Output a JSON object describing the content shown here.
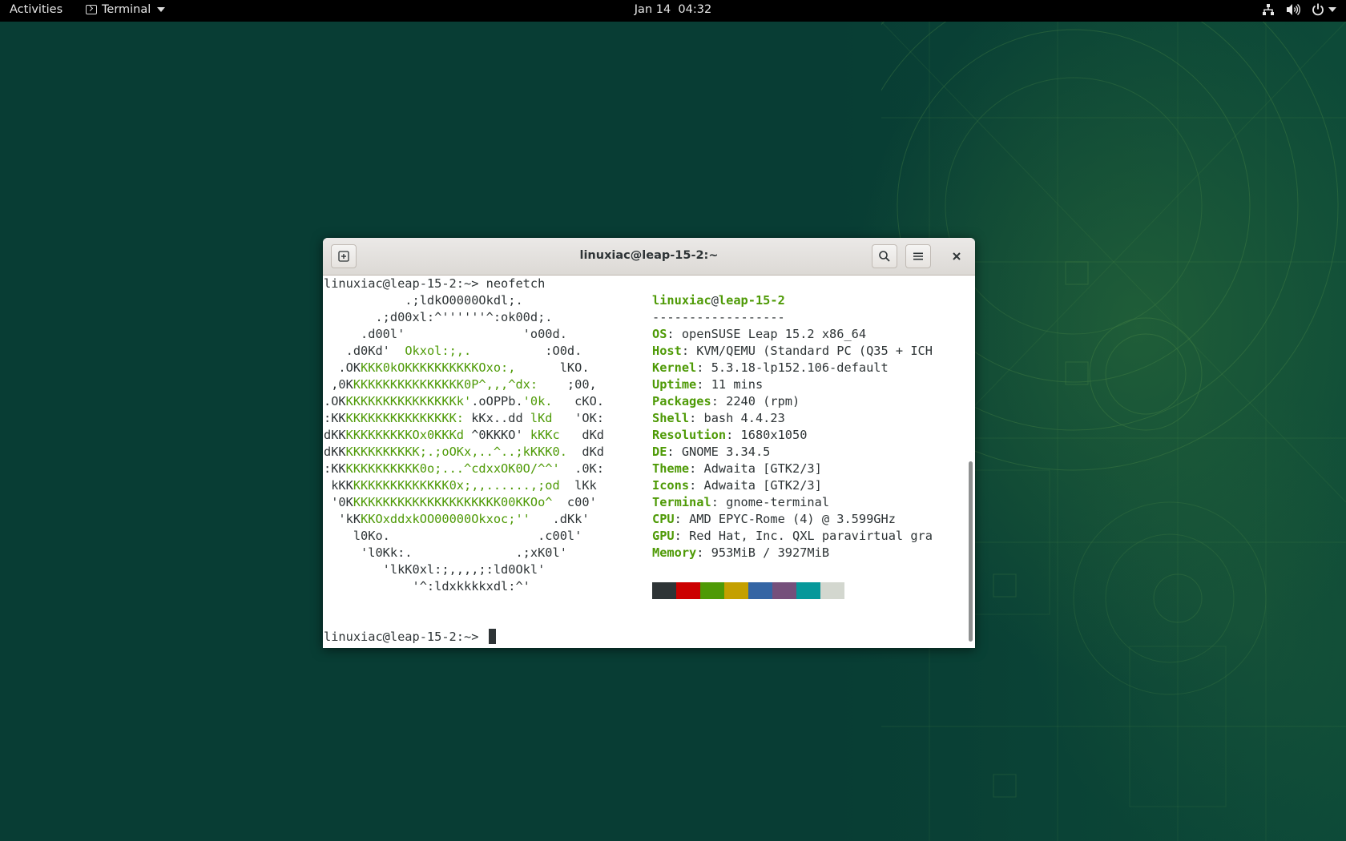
{
  "topbar": {
    "activities": "Activities",
    "app_name": "Terminal",
    "clock": "Jan 14  04:32"
  },
  "window": {
    "title": "linuxiac@leap-15-2:~"
  },
  "terminal": {
    "command_line": "linuxiac@leap-15-2:~> neofetch",
    "prompt": "linuxiac@leap-15-2:~> ",
    "user": "linuxiac",
    "at": "@",
    "host": "leap-15-2",
    "separator": "------------------",
    "info": [
      {
        "key": "OS",
        "value": "openSUSE Leap 15.2 x86_64"
      },
      {
        "key": "Host",
        "value": "KVM/QEMU (Standard PC (Q35 + ICH"
      },
      {
        "key": "Kernel",
        "value": "5.3.18-lp152.106-default"
      },
      {
        "key": "Uptime",
        "value": "11 mins"
      },
      {
        "key": "Packages",
        "value": "2240 (rpm)"
      },
      {
        "key": "Shell",
        "value": "bash 4.4.23"
      },
      {
        "key": "Resolution",
        "value": "1680x1050"
      },
      {
        "key": "DE",
        "value": "GNOME 3.34.5"
      },
      {
        "key": "Theme",
        "value": "Adwaita [GTK2/3]"
      },
      {
        "key": "Icons",
        "value": "Adwaita [GTK2/3]"
      },
      {
        "key": "Terminal",
        "value": "gnome-terminal"
      },
      {
        "key": "CPU",
        "value": "AMD EPYC-Rome (4) @ 3.599GHz"
      },
      {
        "key": "GPU",
        "value": "Red Hat, Inc. QXL paravirtual gra"
      },
      {
        "key": "Memory",
        "value": "953MiB / 3927MiB"
      }
    ],
    "logo_lines": [
      [
        [
          "b",
          "           .;ldkO0000Okdl;."
        ]
      ],
      [
        [
          "b",
          "       .;d00xl:^''''''^:ok00d;."
        ]
      ],
      [
        [
          "b",
          "     .d00l'                'o00d."
        ]
      ],
      [
        [
          "b",
          "   .d0Kd'  "
        ],
        [
          "g",
          "Okxol:;,."
        ],
        [
          "b",
          "          :O0d."
        ]
      ],
      [
        [
          "b",
          "  .OK"
        ],
        [
          "g",
          "KKK0kOKKKKKKKKKKOxo:,"
        ],
        [
          "b",
          "      lKO."
        ]
      ],
      [
        [
          "b",
          " ,0K"
        ],
        [
          "g",
          "KKKKKKKKKKKKKKK0P^,,,^dx:"
        ],
        [
          "b",
          "    ;00,"
        ]
      ],
      [
        [
          "b",
          ".OK"
        ],
        [
          "g",
          "KKKKKKKKKKKKKKKk'"
        ],
        [
          "b",
          ".oOPPb."
        ],
        [
          "g",
          "'0k."
        ],
        [
          "b",
          "   cKO."
        ]
      ],
      [
        [
          "b",
          ":KK"
        ],
        [
          "g",
          "KKKKKKKKKKKKKKK: "
        ],
        [
          "b",
          "kKx..dd "
        ],
        [
          "g",
          "lKd"
        ],
        [
          "b",
          "   'OK:"
        ]
      ],
      [
        [
          "b",
          "dKK"
        ],
        [
          "g",
          "KKKKKKKKKOx0KKKd "
        ],
        [
          "b",
          "^0KKKO' "
        ],
        [
          "g",
          "kKKc"
        ],
        [
          "b",
          "   dKd"
        ]
      ],
      [
        [
          "b",
          "dKK"
        ],
        [
          "g",
          "KKKKKKKKKK;.;oOKx,..^..;kKKK0."
        ],
        [
          "b",
          "  dKd"
        ]
      ],
      [
        [
          "b",
          ":KK"
        ],
        [
          "g",
          "KKKKKKKKKK0o;...^cdxxOK0O/^^'"
        ],
        [
          "b",
          "  .0K:"
        ]
      ],
      [
        [
          "b",
          " kKK"
        ],
        [
          "g",
          "KKKKKKKKKKKKK0x;,,......,;od"
        ],
        [
          "b",
          "  lKk"
        ]
      ],
      [
        [
          "b",
          " '0K"
        ],
        [
          "g",
          "KKKKKKKKKKKKKKKKKKKK00KKOo^"
        ],
        [
          "b",
          "  c00'"
        ]
      ],
      [
        [
          "b",
          "  'kK"
        ],
        [
          "g",
          "KKOxddxkOO00000Okxoc;''"
        ],
        [
          "b",
          "   .dKk'"
        ]
      ],
      [
        [
          "b",
          "    l0Ko.                    .c00l'"
        ]
      ],
      [
        [
          "b",
          "     'l0Kk:.              .;xK0l'"
        ]
      ],
      [
        [
          "b",
          "        'lkK0xl:;,,,,;:ld0Okl'"
        ]
      ],
      [
        [
          "b",
          "            '^:ldxkkkkxdl:^'"
        ]
      ]
    ],
    "palette": [
      "#2e3436",
      "#cc0000",
      "#4e9a06",
      "#c4a000",
      "#3465a4",
      "#75507b",
      "#06989a",
      "#d3d7cf"
    ]
  },
  "icons": {
    "network": "network-icon",
    "volume": "volume-icon",
    "power": "power-icon",
    "new_tab": "new-tab-icon",
    "search": "search-icon",
    "menu": "hamburger-menu-icon",
    "close": "close-icon"
  }
}
